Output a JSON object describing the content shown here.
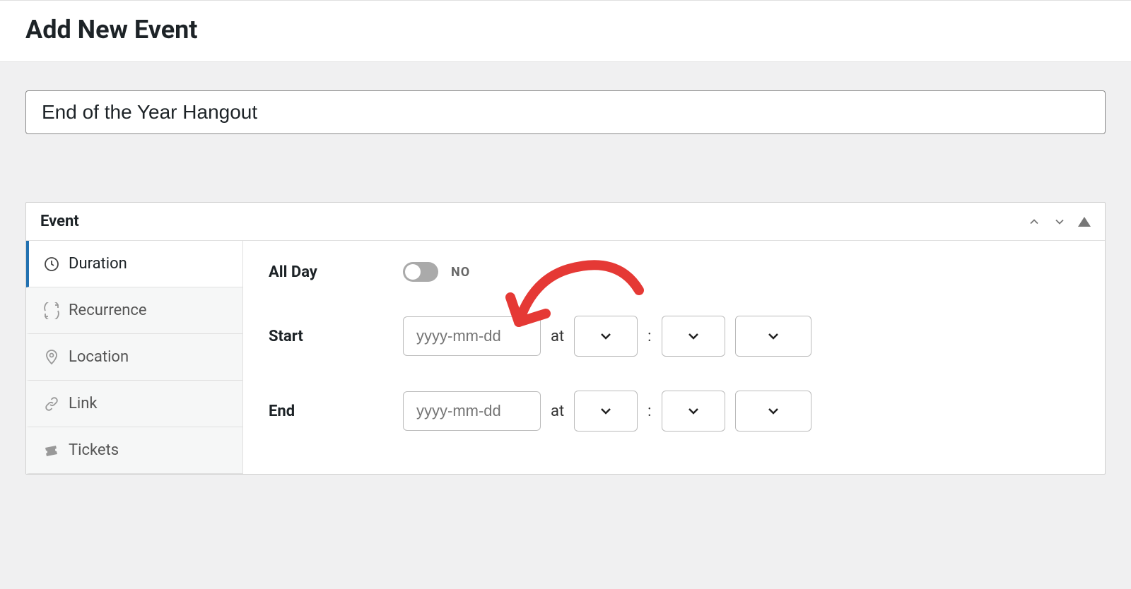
{
  "page_title": "Add New Event",
  "event_title": "End of the Year Hangout",
  "panel": {
    "title": "Event",
    "tabs": [
      {
        "label": "Duration"
      },
      {
        "label": "Recurrence"
      },
      {
        "label": "Location"
      },
      {
        "label": "Link"
      },
      {
        "label": "Tickets"
      }
    ]
  },
  "form": {
    "all_day": {
      "label": "All Day",
      "value": "NO"
    },
    "start": {
      "label": "Start",
      "placeholder": "yyyy-mm-dd",
      "at": "at",
      "colon": ":"
    },
    "end": {
      "label": "End",
      "placeholder": "yyyy-mm-dd",
      "at": "at",
      "colon": ":"
    }
  }
}
